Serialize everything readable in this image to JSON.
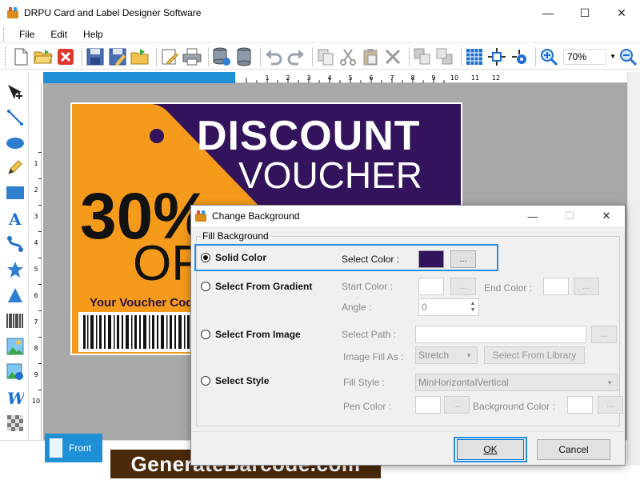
{
  "window": {
    "title": "DRPU Card and Label Designer Software",
    "minimize": "—",
    "maximize": "☐",
    "close": "✕"
  },
  "menu": {
    "items": [
      "File",
      "Edit",
      "Help"
    ]
  },
  "toolbar": {
    "zoom_value": "70%"
  },
  "ruler": {
    "ticks": [
      "1",
      "2",
      "3",
      "4",
      "5",
      "6",
      "7",
      "8",
      "9",
      "10",
      "11",
      "12"
    ],
    "v_ticks": [
      "1",
      "2",
      "3",
      "4",
      "5",
      "6",
      "7",
      "8",
      "9",
      "10"
    ]
  },
  "card": {
    "line1": "DISCOUNT",
    "line2": "VOUCHER",
    "percent": "30%",
    "off": "OFF",
    "code_label": "Your Voucher Code"
  },
  "tabs": {
    "front": "Front"
  },
  "branding": {
    "text": "GenerateBarcode.com"
  },
  "dialog": {
    "title": "Change Background",
    "group_label": "Fill Background",
    "solid": {
      "label": "Solid Color",
      "select_color_label": "Select Color :",
      "swatch_color": "#33145c",
      "button": "..."
    },
    "gradient": {
      "label": "Select From Gradient",
      "start_label": "Start Color :",
      "end_label": "End Color :",
      "angle_label": "Angle :",
      "angle_value": "0",
      "start_button": "...",
      "end_button": "..."
    },
    "image": {
      "label": "Select From Image",
      "path_label": "Select Path :",
      "fill_as_label": "Image Fill As :",
      "fill_as_value": "Stretch",
      "library_button": "Select From Library",
      "path_button": "..."
    },
    "style": {
      "label": "Select Style",
      "fill_style_label": "Fill Style :",
      "fill_style_value": "MinHorizontalVertical",
      "pen_color_label": "Pen Color :",
      "bg_color_label": "Background Color :",
      "pen_button": "...",
      "bg_button": "..."
    },
    "ok": "OK",
    "cancel": "Cancel"
  },
  "colors": {
    "accent": "#1f8fd6",
    "card_purple": "#33145c",
    "card_orange": "#f59a1a",
    "highlight": "#2a8fe0"
  }
}
